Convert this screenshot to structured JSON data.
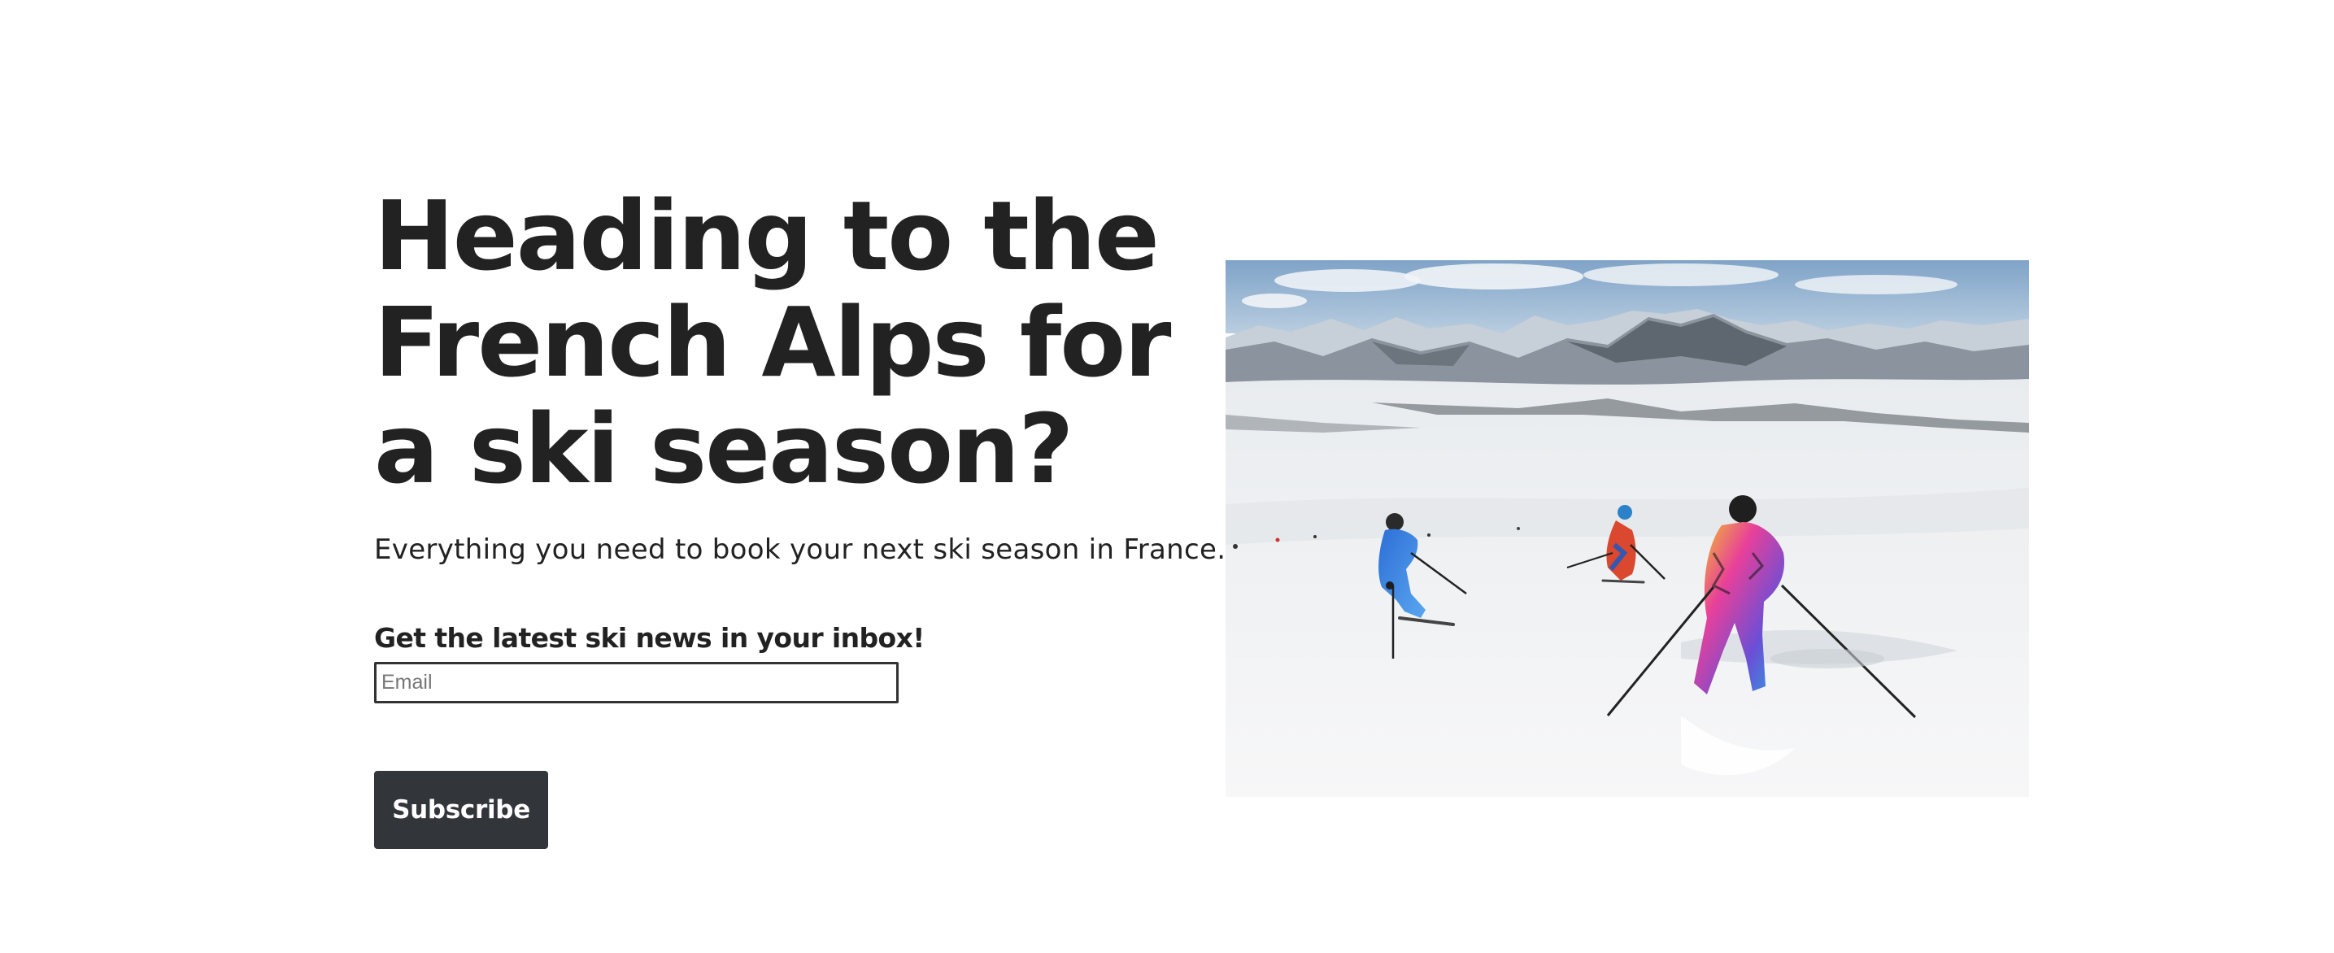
{
  "hero": {
    "headline_lines": [
      "Heading to the",
      "French Alps for",
      "a ski season?"
    ],
    "subtitle": "Everything you need to book your next ski season in France."
  },
  "signup": {
    "heading": "Get the latest ski news in your inbox!",
    "email_placeholder": "Email",
    "email_value": "",
    "button_label": "Subscribe"
  },
  "image": {
    "subject": "three skiers in colorful suits descending a snowy slope with mountain range behind"
  },
  "colors": {
    "text": "#222222",
    "button_bg": "#32353a",
    "button_text": "#ffffff",
    "input_border": "#333333",
    "background": "#ffffff"
  }
}
